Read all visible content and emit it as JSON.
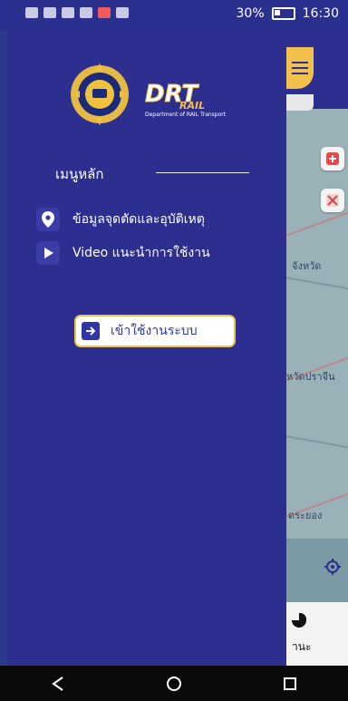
{
  "statusbar": {
    "battery_percent": "30%",
    "time": "16:30"
  },
  "drawer": {
    "menu_title": "เมนูหลัก",
    "items": [
      {
        "label": "ข้อมูลจุดตัดและอุบัติเหตุ",
        "icon": "location-pin-icon"
      },
      {
        "label": "Video แนะนำการใช้งาน",
        "icon": "play-icon"
      }
    ],
    "login_label": "เข้าใช้งานระบบ",
    "logo": {
      "drt_text": "DRT",
      "rail_text": "RAIL",
      "subtitle": "Department of RAIL Transport"
    }
  },
  "map": {
    "labels": [
      "จังหวัด",
      "หวัดปราจีน",
      "ดระยอง",
      "านะ"
    ]
  },
  "colors": {
    "drawer_bg": "#2c2f8f",
    "accent_gold": "#f2c14d",
    "login_text": "#2f36a6"
  }
}
